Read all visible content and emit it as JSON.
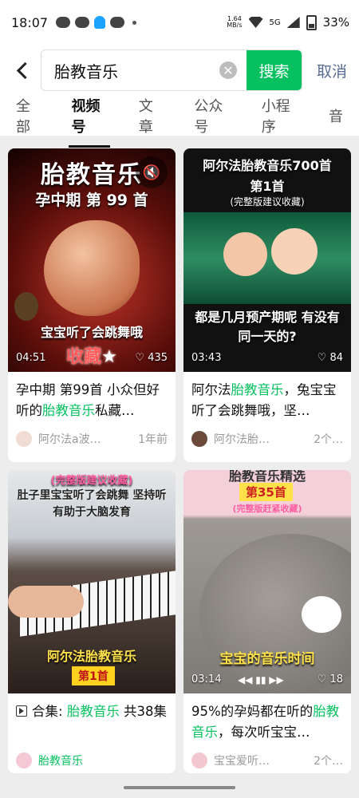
{
  "status": {
    "time": "18:07",
    "net_speed_top": "1.64",
    "net_speed_unit": "MB/s",
    "sim": "5G",
    "battery": "33%"
  },
  "search": {
    "query": "胎教音乐",
    "button": "搜索",
    "cancel": "取消"
  },
  "tabs": [
    "全部",
    "视频号",
    "文章",
    "公众号",
    "小程序",
    "音"
  ],
  "cards": [
    {
      "thumb_title": "胎教音乐",
      "thumb_subtitle": "孕中期 第 99 首",
      "thumb_bottom": "宝宝听了会跳舞哦",
      "thumb_badge": "收藏",
      "duration": "04:51",
      "likes": "♡ 435",
      "title_pre": "孕中期 第99首 小众但好听的",
      "title_hl": "胎教音乐",
      "title_post": "私藏…",
      "author": "阿尔法a波…",
      "age": "1年前"
    },
    {
      "thumb_title": "阿尔法胎教音乐700首",
      "thumb_subtitle": "第1首",
      "thumb_note": "(完整版建议收藏)",
      "thumb_bottom": "都是几月预产期呢 有没有同一天的?",
      "duration": "03:43",
      "likes": "♡ 84",
      "title_pre": "阿尔法",
      "title_hl": "胎教音乐",
      "title_post": "，兔宝宝听了会跳舞哦，坚…",
      "author": "阿尔法胎…",
      "age": "2个…"
    },
    {
      "thumb_top": "(完整版建议收藏)",
      "thumb_title": "肚子里宝宝听了会跳舞 坚持听有助于大脑发育",
      "thumb_bottom": "阿尔法胎教音乐",
      "thumb_badge": "第1首",
      "title_prefix": "合集: ",
      "title_hl": "胎教音乐",
      "title_post": " 共38集",
      "author": "胎教音乐"
    },
    {
      "thumb_top": "胎教音乐精选",
      "thumb_title": "第35首",
      "thumb_note": "(完整版赶紧收藏)",
      "thumb_bottom": "宝宝的音乐时间",
      "duration": "03:14",
      "likes": "♡ 18",
      "title_pre": "95%的孕妈都在听的",
      "title_hl": "胎教音乐",
      "title_post": "，每次听宝宝…",
      "author": "宝宝爱听…",
      "age": "2个…"
    }
  ],
  "colors": {
    "accent": "#07c160",
    "link": "#576b95"
  }
}
